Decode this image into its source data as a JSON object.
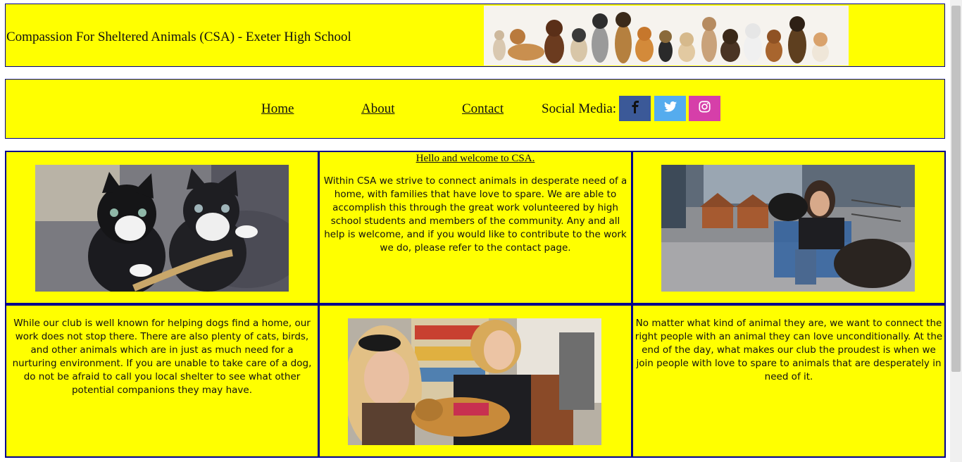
{
  "header": {
    "title": "Compassion For Sheltered Animals (CSA) - Exeter High School",
    "banner_image": "row-of-dogs-banner"
  },
  "nav": {
    "links": [
      "Home",
      "About",
      "Contact"
    ],
    "social_label": "Social Media:",
    "social": [
      {
        "icon": "facebook-icon",
        "color": "#3b5998"
      },
      {
        "icon": "twitter-icon",
        "color": "#55acee"
      },
      {
        "icon": "instagram-icon",
        "color": "#d63fa9"
      }
    ]
  },
  "content": {
    "welcome_heading": "Hello and welcome to CSA.",
    "intro": "Within CSA we strive to connect animals in desperate need of a home, with families that have love to spare. We are able to accomplish this through the great work volunteered by high school students and members of the community. Any and all help is welcome, and if you would like to contribute to the work we do, please refer to the contact page.",
    "dogs_text": "While our club is well known for helping dogs find a home, our work does not stop there. There are also plenty of cats, birds, and other animals which are in just as much need for a nurturing environment. If you are unable to take care of a dog, do not be afraid to call you local shelter to see what other potential companions they may have.",
    "mission_text": "No matter what kind of animal they are, we want to connect the right people with an animal they can love unconditionally. At the end of the day, what makes our club the proudest is when we join people with love to spare to animals that are desperately in need of it.",
    "images": [
      "kittens-photo",
      "woman-with-dog-photo",
      "volunteers-with-dog-photo"
    ]
  },
  "colors": {
    "background": "#ffff00",
    "border": "#00008b"
  }
}
